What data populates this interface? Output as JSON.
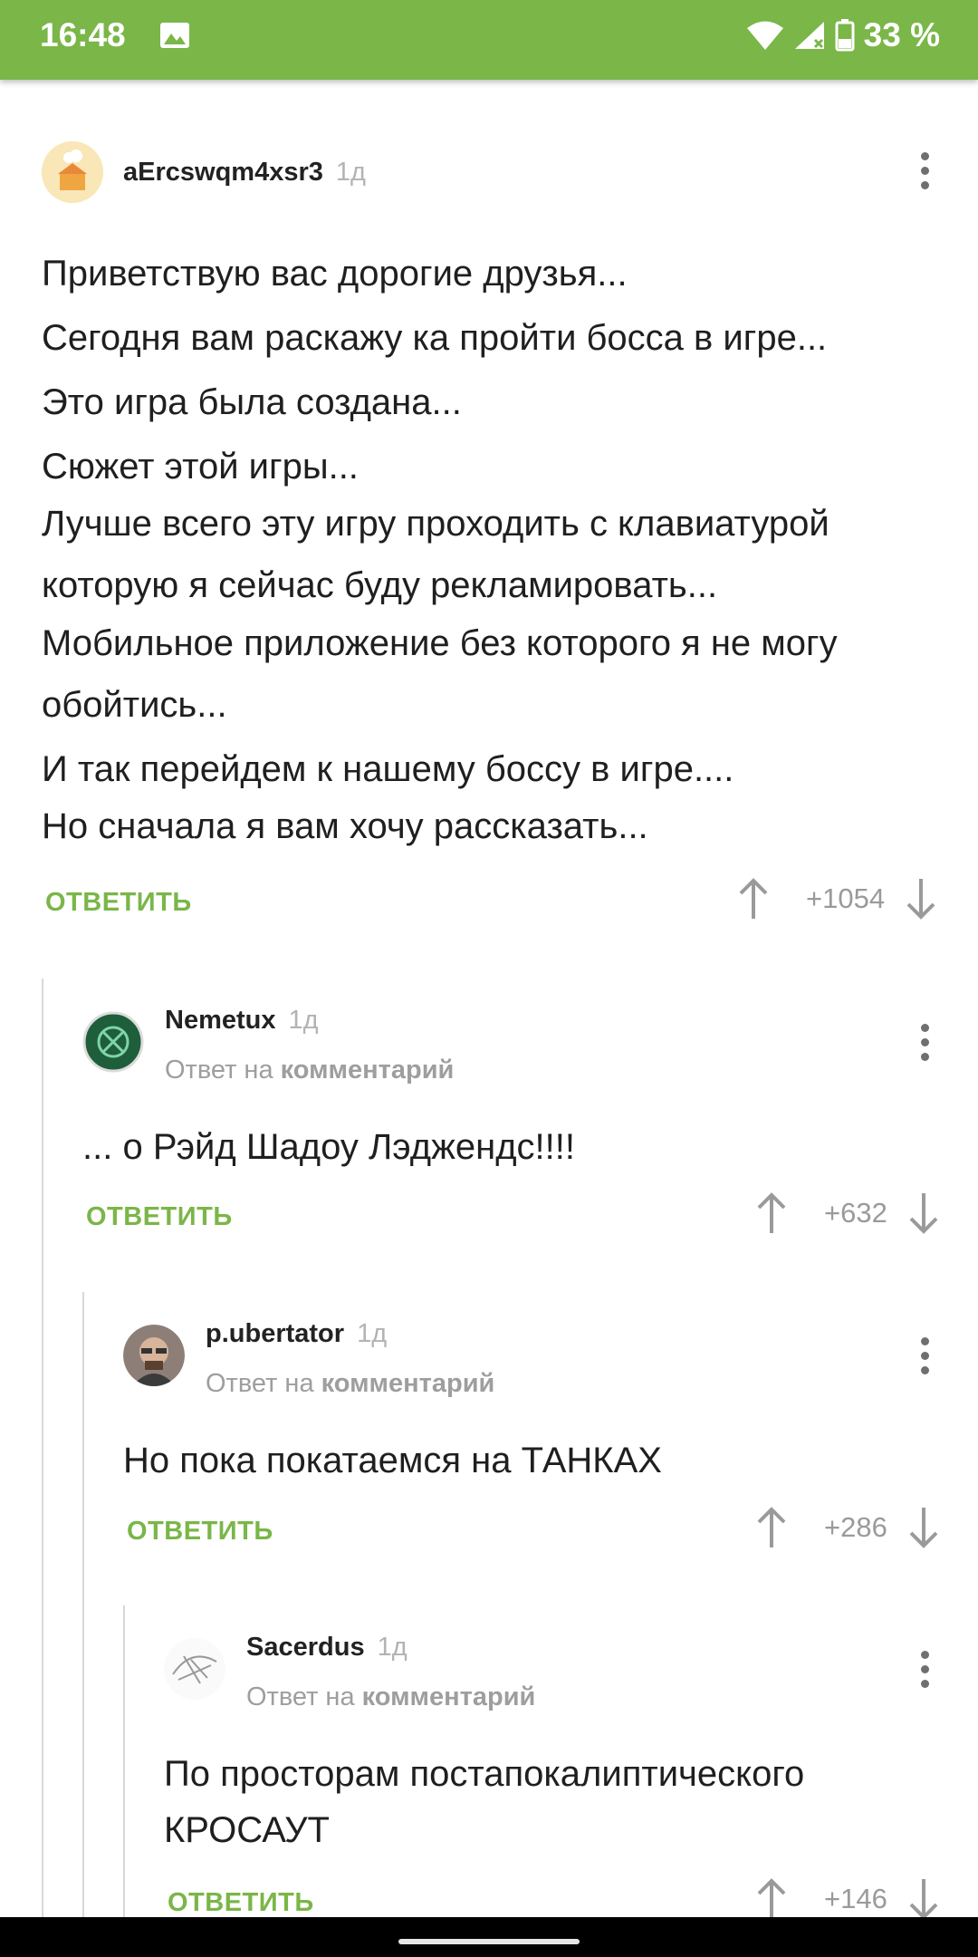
{
  "status_bar": {
    "time": "16:48",
    "battery": "33 %",
    "icons": [
      "image-icon",
      "wifi-icon",
      "signal-icon",
      "battery-icon"
    ]
  },
  "comments": [
    {
      "author": "aErcswqm4xsr3",
      "time": "1д",
      "reply_to": null,
      "lines": [
        "Приветствую вас дорогие друзья...",
        "Сегодня вам раскажу ка пройти босса в игре...",
        "Это игра была создана...",
        "Сюжет этой игры...",
        "Лучше всего эту игру проходить с клавиатурой",
        "которую я сейчас буду рекламировать...",
        "Мобильное приложение без которого я не могу",
        "обойтись...",
        "И так перейдем к нашему боссу в игре....",
        "Но сначала я вам хочу рассказать..."
      ],
      "reply_label": "ОТВЕТИТЬ",
      "score": "+1054"
    },
    {
      "author": "Nemetux",
      "time": "1д",
      "reply_prefix": "Ответ на",
      "reply_link": "комментарий",
      "lines": [
        "... о Рэйд Шадоу Лэдженд​с!!!!"
      ],
      "reply_label": "ОТВЕТИТЬ",
      "score": "+632"
    },
    {
      "author": "p.ubertator",
      "time": "1д",
      "reply_prefix": "Ответ на",
      "reply_link": "комментарий",
      "lines": [
        "Но пока покатаемся на ТАНКАХ"
      ],
      "reply_label": "ОТВЕТИТЬ",
      "score": "+286"
    },
    {
      "author": "Sacerdus",
      "time": "1д",
      "reply_prefix": "Ответ на",
      "reply_link": "комментарий",
      "lines": [
        "По просторам постапокалиптического",
        "КРОСАУТ"
      ],
      "reply_label": "ОТВЕТИТЬ",
      "score": "+146"
    }
  ],
  "colors": {
    "accent": "#7ab648",
    "muted": "#9e9e9e",
    "text": "#1f1f1f"
  }
}
